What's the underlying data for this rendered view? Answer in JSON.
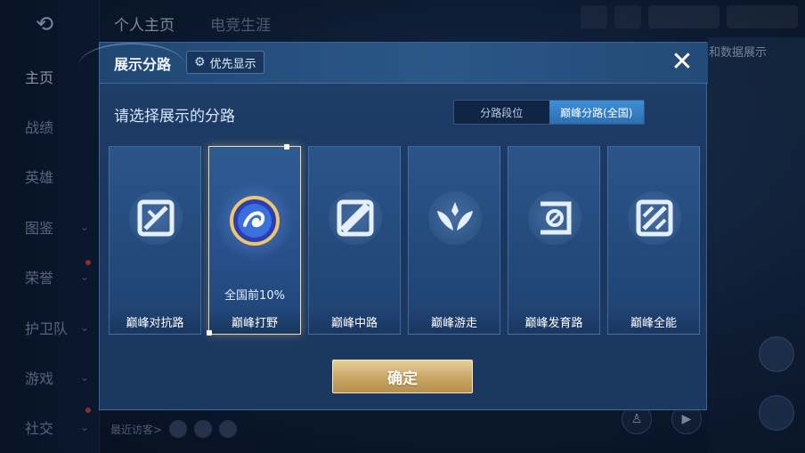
{
  "background": {
    "back_icon": "back-arrow-icon",
    "nav_items": [
      {
        "label": "主页",
        "active": true
      },
      {
        "label": "战绩",
        "active": false
      },
      {
        "label": "英雄",
        "active": false
      },
      {
        "label": "图鉴",
        "active": false
      },
      {
        "label": "荣誉",
        "active": false
      },
      {
        "label": "护卫队",
        "active": false
      },
      {
        "label": "游戏",
        "active": false
      },
      {
        "label": "社交",
        "active": false
      }
    ],
    "top_tabs": [
      "个人主页",
      "电竞生涯"
    ],
    "right_panel_text": "和数据展示",
    "recent_visitors_label": "最近访客>"
  },
  "modal": {
    "title": "展示分路",
    "priority_button": "优先显示",
    "close_icon": "close-icon",
    "subtitle": "请选择展示的分路",
    "segments": [
      {
        "label": "分路段位",
        "active": false
      },
      {
        "label": "巅峰分路(全国)",
        "active": true
      }
    ],
    "roles": [
      {
        "label": "巅峰对抗路",
        "icon": "clash-lane-icon",
        "selected": false,
        "rank": ""
      },
      {
        "label": "巅峰打野",
        "icon": "jungle-dragon-emblem-icon",
        "selected": true,
        "rank": "全国前10%"
      },
      {
        "label": "巅峰中路",
        "icon": "mid-lane-icon",
        "selected": false,
        "rank": ""
      },
      {
        "label": "巅峰游走",
        "icon": "roam-wings-icon",
        "selected": false,
        "rank": ""
      },
      {
        "label": "巅峰发育路",
        "icon": "farm-lane-icon",
        "selected": false,
        "rank": ""
      },
      {
        "label": "巅峰全能",
        "icon": "all-round-icon",
        "selected": false,
        "rank": ""
      }
    ],
    "confirm_button": "确定"
  }
}
